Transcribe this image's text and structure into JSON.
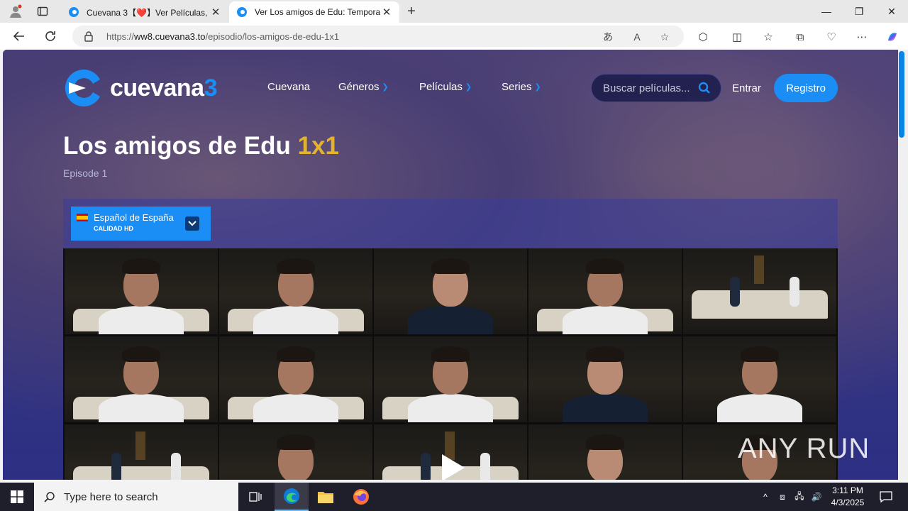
{
  "browser": {
    "tabs": [
      {
        "title": "Cuevana 3【❤️】Ver Películas, ver",
        "active": false
      },
      {
        "title": "Ver Los amigos de Edu: Tempora",
        "active": true
      }
    ],
    "url_prefix": "https://",
    "url_domain": "ww8.cuevana3.to",
    "url_path": "/episodio/los-amigos-de-edu-1x1",
    "accent": "#0b84e8"
  },
  "site": {
    "logo_text": "cuevana",
    "logo_num": "3",
    "nav": [
      {
        "label": "Cuevana",
        "has_dropdown": false
      },
      {
        "label": "Géneros",
        "has_dropdown": true
      },
      {
        "label": "Películas",
        "has_dropdown": true
      },
      {
        "label": "Series",
        "has_dropdown": true
      }
    ],
    "search_placeholder": "Buscar películas...",
    "login_label": "Entrar",
    "register_label": "Registro",
    "brand_color": "#1a8ef5"
  },
  "episode": {
    "title": "Los amigos de Edu",
    "code": "1x1",
    "subtitle": "Episode 1"
  },
  "player": {
    "language": "Español de España",
    "quality": "CALIDAD HD"
  },
  "watermark": "ANY RUN",
  "taskbar": {
    "search_placeholder": "Type here to search",
    "time": "3:11 PM",
    "date": "4/3/2025"
  }
}
